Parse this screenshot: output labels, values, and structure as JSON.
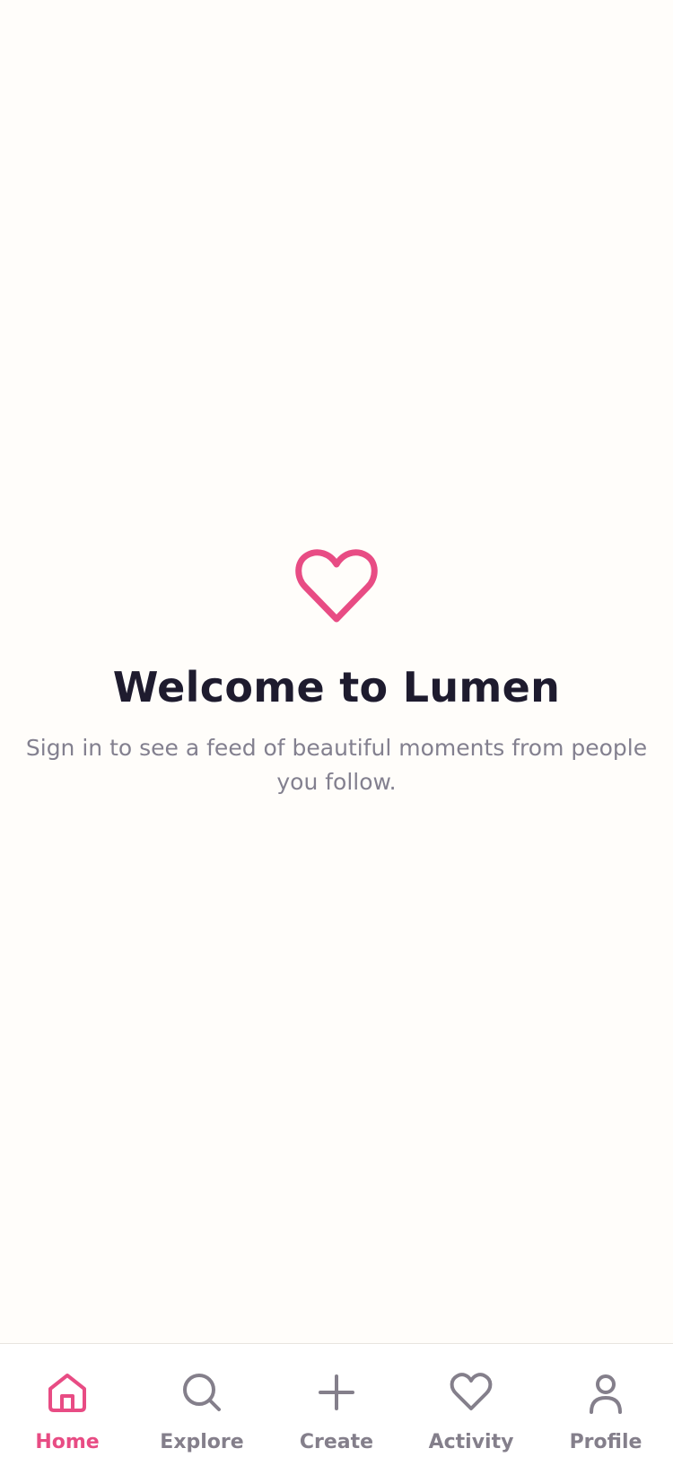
{
  "colors": {
    "background": "#fffdfa",
    "accent": "#e84c84",
    "title": "#1e1b2e",
    "muted": "#83808f",
    "tab_inactive": "#847f8b"
  },
  "hero": {
    "icon": "heart-icon",
    "title": "Welcome to Lumen",
    "subtitle": "Sign in to see a feed of beautiful moments from people you follow."
  },
  "tabbar": {
    "active": "Home",
    "items": [
      {
        "label": "Home",
        "icon": "home-icon"
      },
      {
        "label": "Explore",
        "icon": "search-icon"
      },
      {
        "label": "Create",
        "icon": "plus-icon"
      },
      {
        "label": "Activity",
        "icon": "heart-icon"
      },
      {
        "label": "Profile",
        "icon": "user-icon"
      }
    ]
  }
}
